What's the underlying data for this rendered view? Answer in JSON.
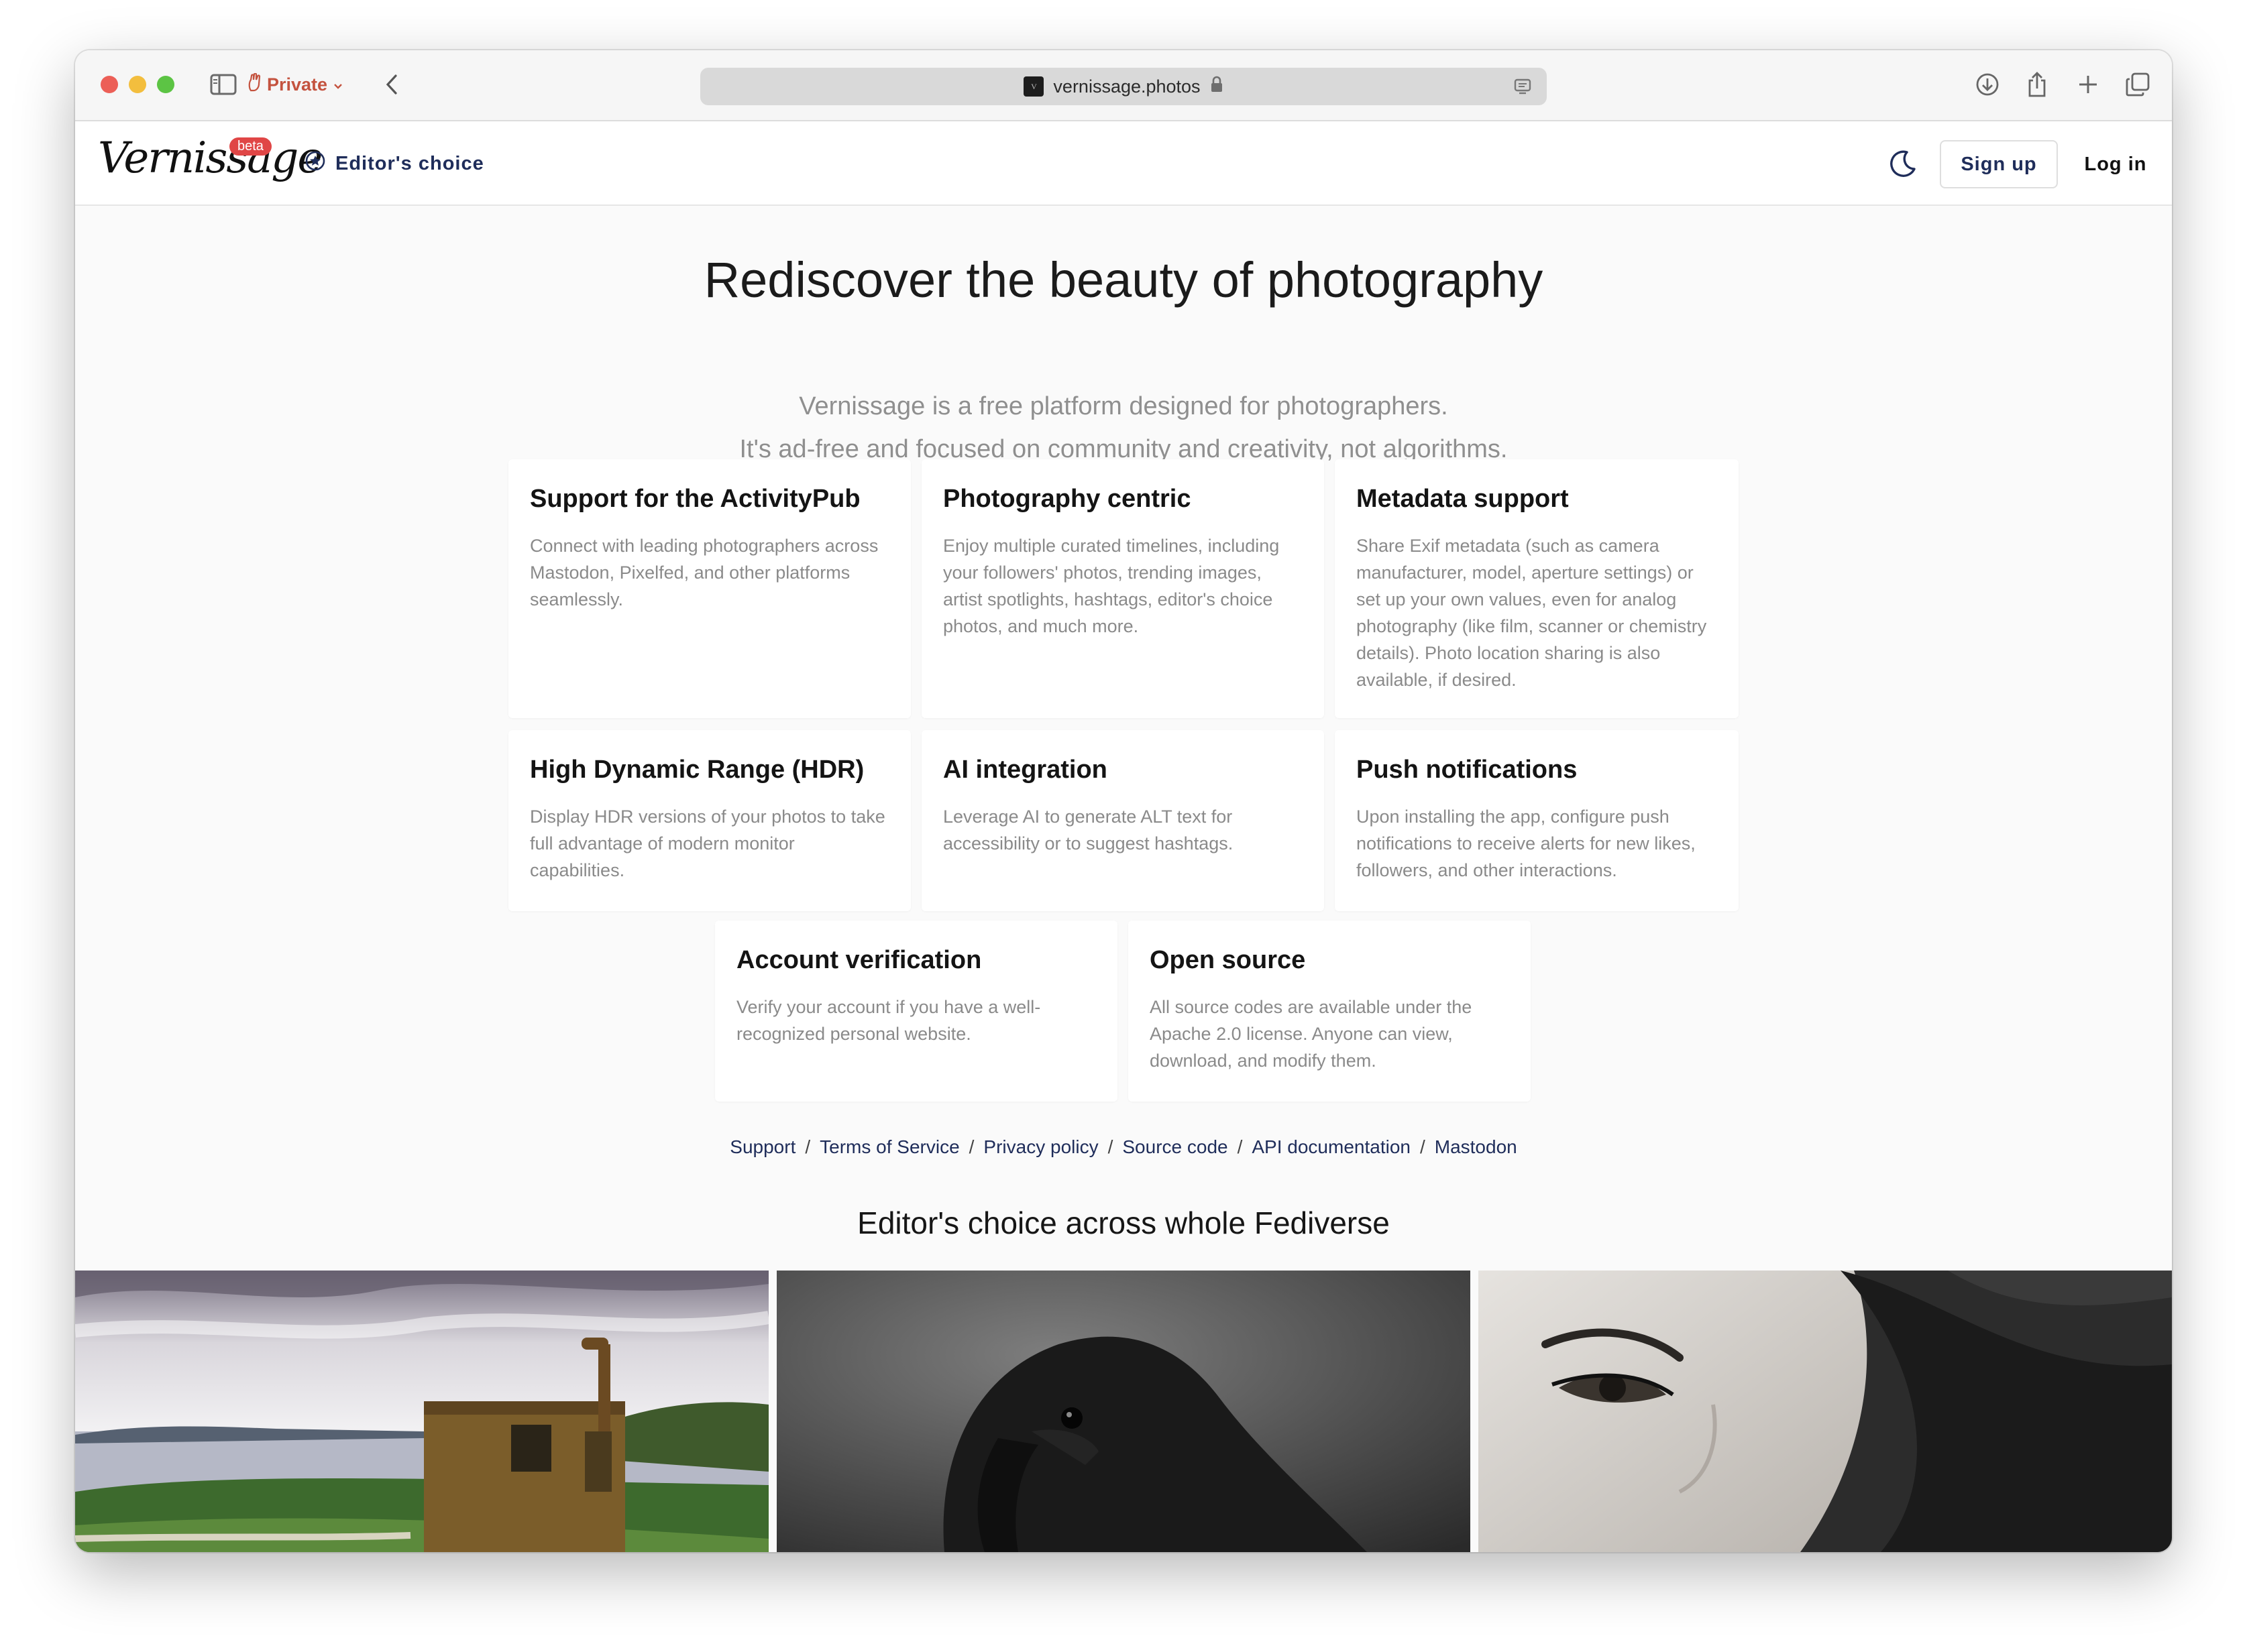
{
  "browser": {
    "private_label": "Private",
    "url": "vernissage.photos"
  },
  "header": {
    "logo_text": "Vernissage",
    "beta_badge": "beta",
    "editors_choice": "Editor's choice",
    "signup": "Sign up",
    "login": "Log in"
  },
  "hero": {
    "title": "Rediscover the beauty of photography",
    "subtitle_line1": "Vernissage is a free platform designed for photographers.",
    "subtitle_line2": "It's ad-free and focused on community and creativity, not algorithms."
  },
  "features": [
    {
      "title": "Support for the ActivityPub",
      "text": "Connect with leading photographers across Mastodon, Pixelfed, and other platforms seamlessly."
    },
    {
      "title": "Photography centric",
      "text": "Enjoy multiple curated timelines, including your followers' photos, trending images, artist spotlights, hashtags, editor's choice photos, and much more."
    },
    {
      "title": "Metadata support",
      "text": "Share Exif metadata (such as camera manufacturer, model, aperture settings) or set up your own values, even for analog photography (like film, scanner or chemistry details). Photo location sharing is also available, if desired."
    },
    {
      "title": "High Dynamic Range (HDR)",
      "text": "Display HDR versions of your photos to take full advantage of modern monitor capabilities."
    },
    {
      "title": "AI integration",
      "text": "Leverage AI to generate ALT text for accessibility or to suggest hashtags."
    },
    {
      "title": "Push notifications",
      "text": "Upon installing the app, configure push notifications to receive alerts for new likes, followers, and other interactions."
    },
    {
      "title": "Account verification",
      "text": "Verify your account if you have a well-recognized personal website."
    },
    {
      "title": "Open source",
      "text": "All source codes are available under the Apache 2.0 license. Anyone can view, download, and modify them."
    }
  ],
  "footer_links": [
    "Support",
    "Terms of Service",
    "Privacy policy",
    "Source code",
    "API documentation",
    "Mastodon"
  ],
  "separator": "/",
  "section_title": "Editor's choice across whole Fediverse",
  "colors": {
    "accent": "#1f2d5a",
    "beta": "#e04646",
    "private": "#c4533f"
  }
}
